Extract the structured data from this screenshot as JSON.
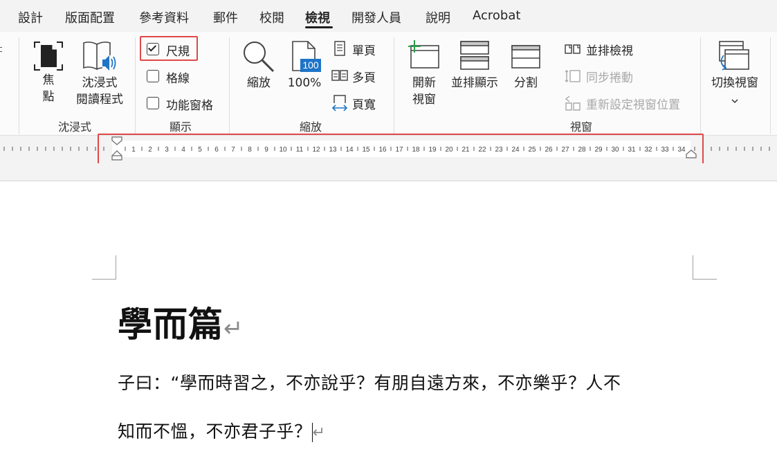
{
  "tabs": [
    {
      "label": "設計"
    },
    {
      "label": "版面配置"
    },
    {
      "label": "參考資料"
    },
    {
      "label": "郵件"
    },
    {
      "label": "校閱"
    },
    {
      "label": "檢視",
      "active": true
    },
    {
      "label": "開發人員"
    },
    {
      "label": "說明"
    },
    {
      "label": "Acrobat"
    }
  ],
  "ribbon": {
    "immersive": {
      "group_label": "沈浸式",
      "focus_label": "焦\n點",
      "reader_label": "沈浸式\n閱讀程式"
    },
    "show": {
      "group_label": "顯示",
      "ruler": {
        "label": "尺規",
        "checked": true
      },
      "gridlines": {
        "label": "格線",
        "checked": false
      },
      "nav_pane": {
        "label": "功能窗格",
        "checked": false
      }
    },
    "zoom": {
      "group_label": "縮放",
      "zoom_label": "縮放",
      "percent_label": "100%",
      "percent_badge": "100",
      "one_page": "單頁",
      "multi_page": "多頁",
      "page_width": "頁寬"
    },
    "window": {
      "group_label": "視窗",
      "new_window": "開新\n視窗",
      "arrange_all": "並排顯示",
      "split": "分割",
      "side_by_side": "並排檢視",
      "sync_scroll": "同步捲動",
      "reset_position": "重新設定視窗位置",
      "switch_windows": "切換視窗"
    }
  },
  "ruler": {
    "numbers": [
      "1",
      "2",
      "3",
      "4",
      "5",
      "6",
      "7",
      "8",
      "9",
      "10",
      "11",
      "12",
      "13",
      "14",
      "15",
      "16",
      "17",
      "18",
      "19",
      "20",
      "21",
      "22",
      "23",
      "24",
      "25",
      "26",
      "27",
      "28",
      "29",
      "30",
      "31",
      "32",
      "33",
      "34"
    ]
  },
  "document": {
    "title": "學而篇",
    "line1": "子曰：“學而時習之，不亦說乎？有朋自遠方來，不亦樂乎？人不",
    "line2": "知而不慍，不亦君子乎？",
    "return_mark": "↵"
  },
  "colors": {
    "highlight": "#e04848",
    "accent_blue": "#1e74c8",
    "accent_green": "#2e9e4a"
  }
}
